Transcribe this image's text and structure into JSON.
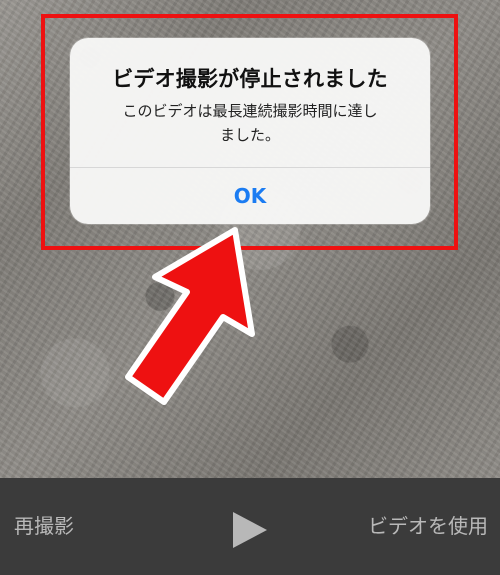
{
  "alert": {
    "title": "ビデオ撮影が停止されました",
    "message": "このビデオは最長連続撮影時間に達しました。",
    "ok_label": "OK"
  },
  "bottom_bar": {
    "retake_label": "再撮影",
    "play_icon": "play-icon",
    "use_video_label": "ビデオを使用"
  },
  "annotation": {
    "highlight_color": "#ee1111",
    "arrow_color": "#ee1111",
    "arrow_icon": "red-arrow-icon"
  }
}
